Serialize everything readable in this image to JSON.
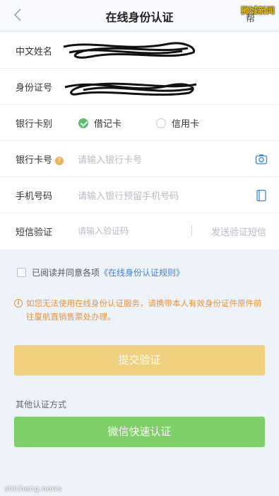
{
  "header": {
    "title": "在线身份认证",
    "right_text": "帮",
    "brand": "狮城新闻"
  },
  "form": {
    "name_label": "中文姓名",
    "id_label": "身份证号",
    "card_type_label": "银行卡别",
    "card_type_options": [
      "借记卡",
      "信用卡"
    ],
    "card_type_selected": "借记卡",
    "card_no_label": "银行卡号",
    "card_no_placeholder": "请输入银行卡号",
    "phone_label": "手机号码",
    "phone_placeholder": "请输入银行预留手机号码",
    "sms_label": "短信验证",
    "sms_placeholder": "请输入验证码",
    "sms_send": "发送验证短信"
  },
  "agree": {
    "text": "已阅读并同意各项",
    "link": "《在线身份认证规则》"
  },
  "notice": "如您无法使用在线身份认证服务，请携带本人有效身份证件原件前往厦航直销售票处办理。",
  "buttons": {
    "submit": "提交验证",
    "other_methods": "其他认证方式",
    "wechat": "微信快速认证"
  },
  "watermark": "shicheng.news",
  "colors": {
    "accent_blue": "#3f82d6",
    "check_green": "#57c26a",
    "submit_bg": "#f0cf7f",
    "wechat_bg": "#7fcf68",
    "notice": "#e8923a"
  }
}
